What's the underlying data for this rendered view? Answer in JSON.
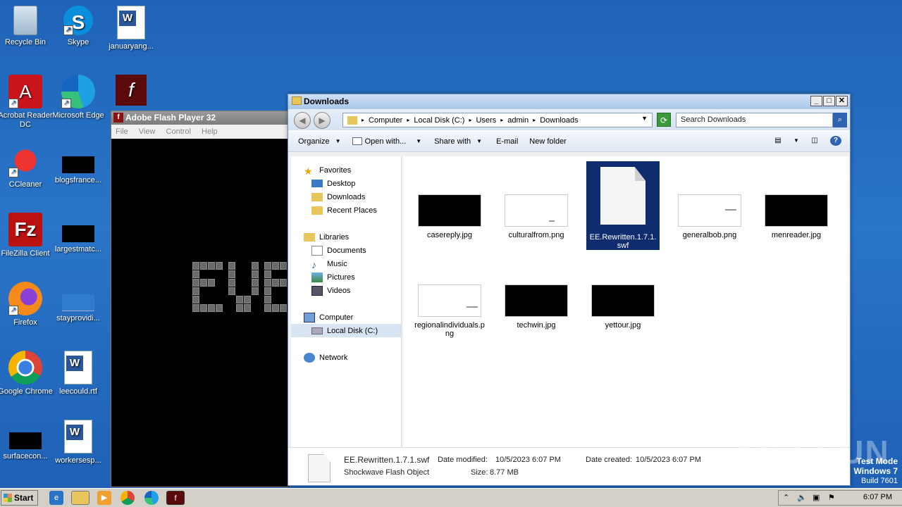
{
  "desktop": {
    "icons": [
      {
        "label": "Recycle Bin"
      },
      {
        "label": "Skype"
      },
      {
        "label": "januaryang..."
      },
      {
        "label": "Acrobat Reader DC"
      },
      {
        "label": "Microsoft Edge"
      },
      {
        "label": "CCleaner"
      },
      {
        "label": "blogsfrance..."
      },
      {
        "label": "FileZilla Client"
      },
      {
        "label": "largestmatc..."
      },
      {
        "label": "Firefox"
      },
      {
        "label": "stayprovidi..."
      },
      {
        "label": "Google Chrome"
      },
      {
        "label": "leecould.rtf"
      },
      {
        "label": "surfacecon..."
      },
      {
        "label": "workersesp..."
      }
    ]
  },
  "flash": {
    "title": "Adobe Flash Player 32",
    "menu": [
      "File",
      "View",
      "Control",
      "Help"
    ]
  },
  "explorer": {
    "title": "Downloads",
    "address": [
      "Computer",
      "Local Disk (C:)",
      "Users",
      "admin",
      "Downloads"
    ],
    "search_placeholder": "Search Downloads",
    "toolbar": {
      "organize": "Organize",
      "open_with": "Open with...",
      "share_with": "Share with",
      "email": "E-mail",
      "new_folder": "New folder"
    },
    "nav": {
      "favorites": "Favorites",
      "desktop": "Desktop",
      "downloads": "Downloads",
      "recent": "Recent Places",
      "libraries": "Libraries",
      "documents": "Documents",
      "music": "Music",
      "pictures": "Pictures",
      "videos": "Videos",
      "computer": "Computer",
      "local_disk": "Local Disk (C:)",
      "network": "Network"
    },
    "files": [
      {
        "name": "casereply.jpg"
      },
      {
        "name": "culturalfrom.png"
      },
      {
        "name": "EE.Rewritten.1.7.1.swf"
      },
      {
        "name": "generalbob.png"
      },
      {
        "name": "menreader.jpg"
      },
      {
        "name": "regionalindividuals.png"
      },
      {
        "name": "techwin.jpg"
      },
      {
        "name": "yettour.jpg"
      }
    ],
    "details": {
      "name": "EE.Rewritten.1.7.1.swf",
      "type": "Shockwave Flash Object",
      "modified_label": "Date modified:",
      "modified": "10/5/2023 6:07 PM",
      "size_label": "Size:",
      "size": "8.77 MB",
      "created_label": "Date created:",
      "created": "10/5/2023 6:07 PM"
    }
  },
  "watermark": "ANY RUN",
  "testmode": {
    "line1": "Test Mode",
    "line2": "Windows 7",
    "line3": "Build 7601"
  },
  "taskbar": {
    "start": "Start",
    "clock": "6:07 PM"
  },
  "colors": {
    "desktop": "#1f63b8",
    "selection": "#0e2c6e",
    "taskbar": "#d4d0c8"
  }
}
